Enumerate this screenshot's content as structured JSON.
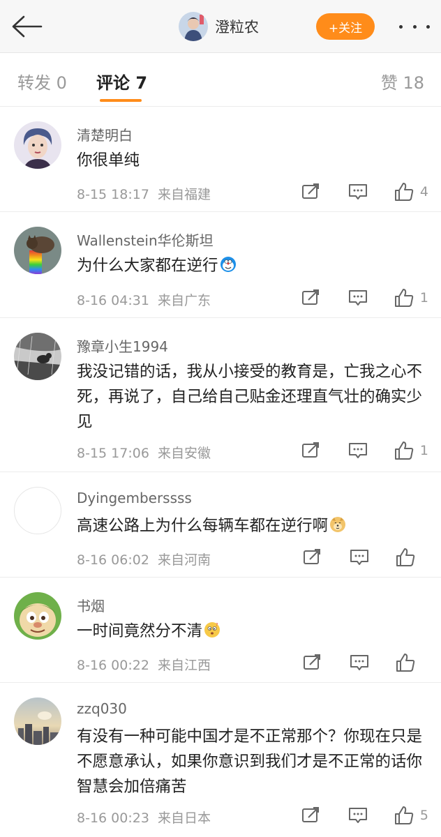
{
  "header": {
    "user_name": "澄粒农",
    "follow_label": "+关注"
  },
  "tabs": [
    {
      "label": "转发 0"
    },
    {
      "label": "评论 7"
    },
    {
      "label": "赞 18"
    }
  ],
  "comments": [
    {
      "user": "清楚明白",
      "text": "你很单纯",
      "time": "8-15 18:17",
      "source": "来自福建",
      "likes": "4",
      "avatar": "illustrated-portrait"
    },
    {
      "user": "Wallenstein华伦斯坦",
      "text": "为什么大家都在逆行",
      "emoji": "doraemon-emoji",
      "time": "8-16 04:31",
      "source": "来自广东",
      "likes": "1",
      "avatar": "rainbow-cat"
    },
    {
      "user": "豫章小生1994",
      "text": "我没记错的话，我从小接受的教育是，亡我之心不死，再说了，自己给自己贴金还理直气壮的确实少见",
      "time": "8-15 17:06",
      "source": "来自安徽",
      "likes": "1",
      "avatar": "bird-in-rain"
    },
    {
      "user": "Dyingemberssss",
      "text": "高速公路上为什么每辆车都在逆行啊",
      "emoji": "doge-emoji",
      "time": "8-16 06:02",
      "source": "来自河南",
      "likes": "",
      "avatar": "blank"
    },
    {
      "user": "书烟",
      "text": "一时间竟然分不清",
      "emoji": "confused-emoji",
      "time": "8-16 00:22",
      "source": "来自江西",
      "likes": "",
      "avatar": "cartoon-face"
    },
    {
      "user": "zzq030",
      "text": "有没有一种可能中国才是不正常那个？你现在只是不愿意承认，如果你意识到我们才是不正常的话你智慧会加倍痛苦",
      "time": "8-16 00:23",
      "source": "来自日本",
      "likes": "5",
      "avatar": "city-sky"
    }
  ],
  "colors": {
    "accent": "#ff8c1a",
    "text_primary": "#222222",
    "text_secondary": "#999999"
  }
}
